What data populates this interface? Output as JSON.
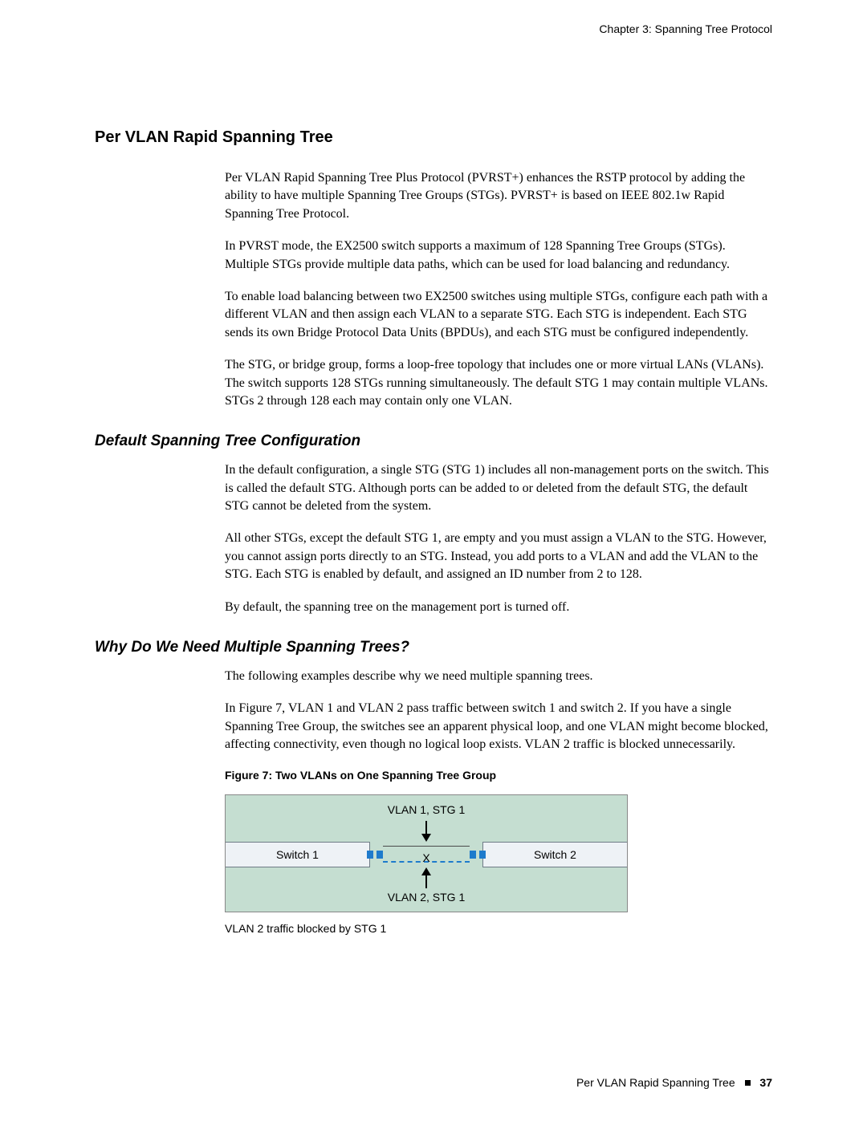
{
  "running_head": "Chapter 3: Spanning Tree Protocol",
  "h1": "Per VLAN Rapid Spanning Tree",
  "section1": {
    "p1": "Per VLAN Rapid Spanning Tree Plus Protocol (PVRST+) enhances the RSTP protocol by adding the ability to have multiple Spanning Tree Groups (STGs). PVRST+ is based on IEEE 802.1w Rapid Spanning Tree Protocol.",
    "p2": "In PVRST mode, the EX2500 switch supports a maximum of 128 Spanning Tree Groups (STGs). Multiple STGs provide multiple data paths, which can be used for load balancing and redundancy.",
    "p3": "To enable load balancing between two EX2500 switches using multiple STGs, configure each path with a different VLAN and then assign each VLAN to a separate STG. Each STG is independent. Each STG sends its own Bridge Protocol Data Units (BPDUs), and each STG must be configured independently.",
    "p4": "The STG, or bridge group, forms a loop-free topology that includes one or more virtual LANs (VLANs). The switch supports 128 STGs running simultaneously. The default STG 1 may contain multiple VLANs. STGs 2 through 128 each may contain only one VLAN."
  },
  "h2a": "Default Spanning Tree Configuration",
  "section2": {
    "p1": "In the default configuration, a single STG (STG 1) includes all non-management ports on the switch. This is called the default STG. Although ports can be added to or deleted from the default STG, the default STG cannot be deleted from the system.",
    "p2": "All other STGs, except the default STG 1, are empty and you must assign a VLAN to the STG. However, you cannot assign ports directly to an STG. Instead, you add ports to a VLAN and add the VLAN to the STG. Each STG is enabled by default, and assigned an ID number from 2 to 128.",
    "p3": "By default, the spanning tree on the management port is turned off."
  },
  "h2b": "Why Do We Need Multiple Spanning Trees?",
  "section3": {
    "p1": "The following examples describe why we need multiple spanning trees.",
    "p2": "In Figure 7, VLAN 1 and VLAN 2 pass traffic between switch 1 and switch 2. If you have a single Spanning Tree Group, the switches see an apparent physical loop, and one VLAN might become blocked, affecting connectivity, even though no logical loop exists. VLAN 2 traffic is blocked unnecessarily."
  },
  "figure": {
    "title": "Figure 7:  Two VLANs on One Spanning Tree Group",
    "top_label": "VLAN 1, STG 1",
    "bottom_label": "VLAN 2, STG 1",
    "switch1": "Switch 1",
    "switch2": "Switch 2",
    "xmark": "X",
    "caption": "VLAN 2 traffic blocked by STG 1"
  },
  "footer": {
    "section": "Per VLAN Rapid Spanning Tree",
    "page": "37"
  }
}
